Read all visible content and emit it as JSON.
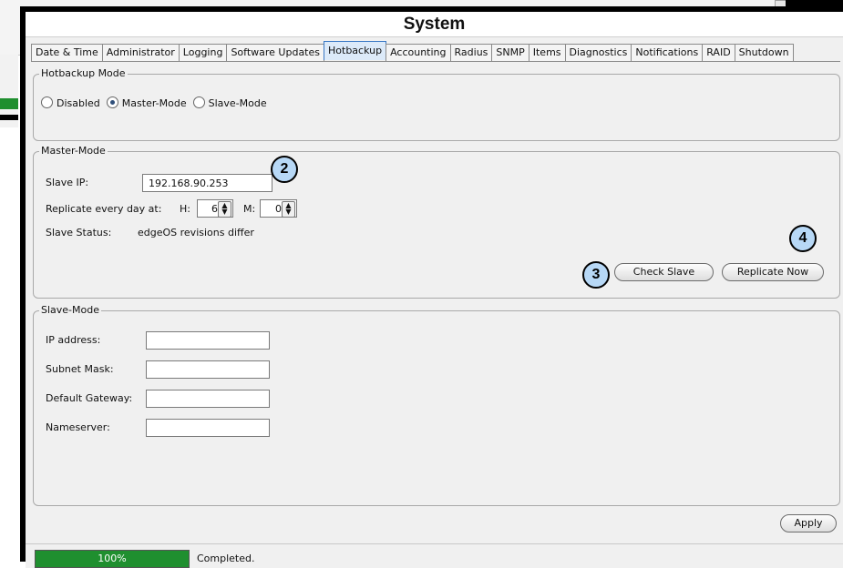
{
  "window": {
    "title": "System"
  },
  "tabs": [
    {
      "label": "Date & Time"
    },
    {
      "label": "Administrator"
    },
    {
      "label": "Logging"
    },
    {
      "label": "Software Updates"
    },
    {
      "label": "Hotbackup",
      "active": true
    },
    {
      "label": "Accounting"
    },
    {
      "label": "Radius"
    },
    {
      "label": "SNMP"
    },
    {
      "label": "Items"
    },
    {
      "label": "Diagnostics"
    },
    {
      "label": "Notifications"
    },
    {
      "label": "RAID"
    },
    {
      "label": "Shutdown"
    }
  ],
  "hotbackup_mode": {
    "legend": "Hotbackup Mode",
    "options": [
      {
        "label": "Disabled",
        "selected": false
      },
      {
        "label": "Master-Mode",
        "selected": true
      },
      {
        "label": "Slave-Mode",
        "selected": false
      }
    ]
  },
  "master_mode": {
    "legend": "Master-Mode",
    "slave_ip_label": "Slave IP:",
    "slave_ip_value": "192.168.90.253",
    "replicate_label": "Replicate every day at:",
    "hour_label": "H:",
    "hour_value": "6",
    "minute_label": "M:",
    "minute_value": "0",
    "slave_status_label": "Slave Status:",
    "slave_status_value": "edgeOS revisions differ",
    "check_slave_button": "Check Slave",
    "replicate_now_button": "Replicate Now"
  },
  "slave_mode": {
    "legend": "Slave-Mode",
    "fields": [
      {
        "label": "IP address:",
        "value": ""
      },
      {
        "label": "Subnet Mask:",
        "value": ""
      },
      {
        "label": "Default Gateway:",
        "value": ""
      },
      {
        "label": "Nameserver:",
        "value": ""
      }
    ]
  },
  "apply_button": "Apply",
  "callouts": [
    "2",
    "3",
    "4"
  ],
  "status": {
    "progress_percent": 100,
    "progress_text": "100%",
    "message": "Completed."
  },
  "colors": {
    "progress": "#1f8f2f",
    "active_tab": "#dceaf9",
    "callout_fill": "#b7d8f6"
  }
}
